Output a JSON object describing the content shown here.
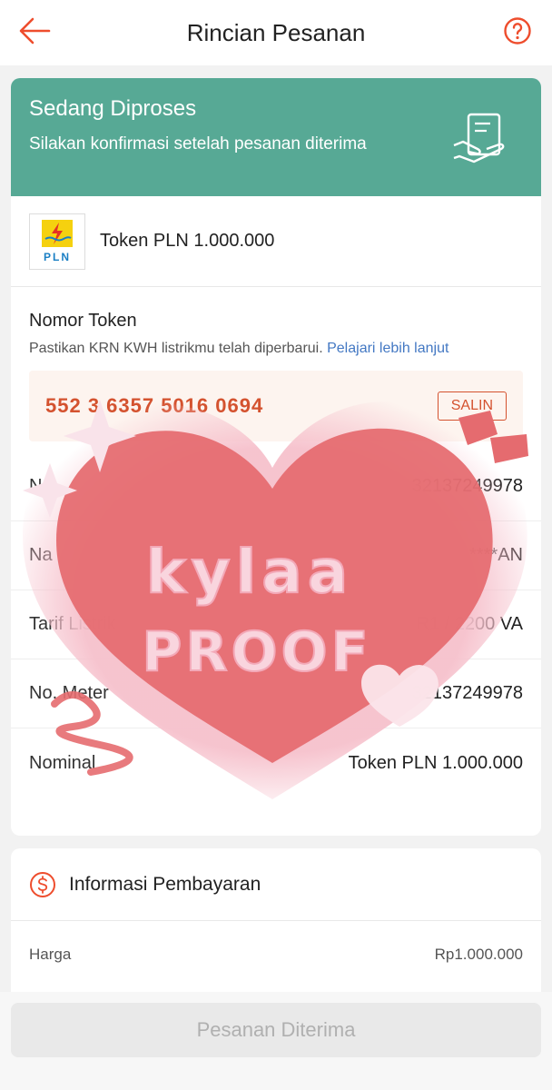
{
  "header": {
    "title": "Rincian Pesanan"
  },
  "status": {
    "title": "Sedang Diproses",
    "subtitle": "Silakan konfirmasi setelah pesanan diterima"
  },
  "product": {
    "logo_text": "PLN",
    "name": "Token PLN 1.000.000"
  },
  "token": {
    "heading": "Nomor Token",
    "note": "Pastikan KRN KWH listrikmu telah diperbarui. ",
    "link": "Pelajari lebih lanjut",
    "value": "552 3 6357 5016 0694",
    "copy_label": "SALIN"
  },
  "details": [
    {
      "label": "No",
      "value": "32137249978"
    },
    {
      "label": "Na",
      "value": "****AN"
    },
    {
      "label": "Tarif Listrik",
      "value": "R1 / 2200 VA"
    },
    {
      "label": "No. Meter",
      "value": "32137249978"
    },
    {
      "label": "Nominal",
      "value": "Token PLN 1.000.000"
    }
  ],
  "payment": {
    "title": "Informasi Pembayaran",
    "price_label": "Harga",
    "price_value": "Rp1.000.000"
  },
  "bottom": {
    "confirm_label": "Pesanan Diterima"
  },
  "watermark": {
    "line1": "kylaa",
    "line2": "PROOF"
  },
  "colors": {
    "accent": "#ee4d2d",
    "status_bg": "#57a995",
    "heart": "#e56b6f",
    "heart_glow": "#f6c1cc"
  }
}
